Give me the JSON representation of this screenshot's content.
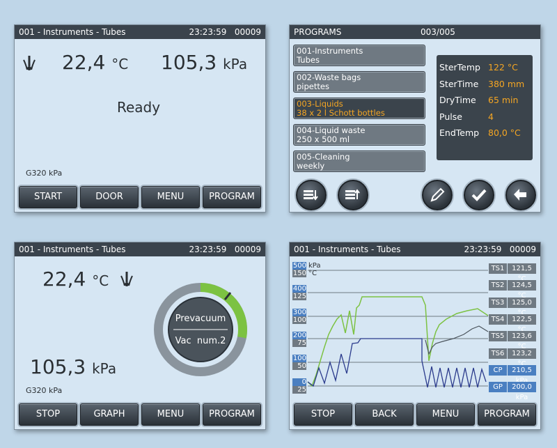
{
  "panel1": {
    "title": "001 - Instruments - Tubes",
    "time": "23:23:59",
    "counter": "00009",
    "temperature": "22,4",
    "temp_unit": "°C",
    "pressure": "105,3",
    "pressure_unit": "kPa",
    "status": "Ready",
    "gauge": "G320 kPa",
    "buttons": [
      "START",
      "DOOR",
      "MENU",
      "PROGRAM"
    ]
  },
  "panel2": {
    "title": "PROGRAMS",
    "page": "003/005",
    "programs": [
      {
        "line1": "001-Instruments",
        "line2": "Tubes"
      },
      {
        "line1": "002-Waste bags",
        "line2": "pipettes"
      },
      {
        "line1": "003-Liquids",
        "line2": "38 x 2 l Schott bottles"
      },
      {
        "line1": "004-Liquid waste",
        "line2": "250 x 500 ml"
      },
      {
        "line1": "005-Cleaning",
        "line2": "weekly"
      }
    ],
    "selected_index": 2,
    "params": [
      {
        "label": "SterTemp",
        "value": "122 °C"
      },
      {
        "label": "SterTime",
        "value": "380 mm"
      },
      {
        "label": "DryTime",
        "value": "65 min"
      },
      {
        "label": "Pulse",
        "value": "4"
      },
      {
        "label": "EndTemp",
        "value": "80,0 °C"
      }
    ],
    "icons": [
      "list-down-icon",
      "list-up-icon",
      "pencil-icon",
      "check-icon",
      "back-arrow-icon"
    ],
    "accent": "#f5a623"
  },
  "panel3": {
    "title": "001 - Instruments - Tubes",
    "time": "23:23:59",
    "counter": "00009",
    "temperature": "22,4",
    "temp_unit": "°C",
    "pressure": "105,3",
    "pressure_unit": "kPa",
    "gauge": "G320 kPa",
    "phase": "Prevacuum",
    "vac": "Vac  num.2",
    "progress_fraction": 0.28,
    "buttons": [
      "STOP",
      "GRAPH",
      "MENU",
      "PROGRAM"
    ]
  },
  "panel4": {
    "title": "001 - Instruments - Tubes",
    "time": "23:23:59",
    "counter": "00009",
    "pressure_axis": [
      "500",
      "400",
      "300",
      "200",
      "100",
      "0"
    ],
    "temp_axis": [
      "150",
      "125",
      "100",
      "75",
      "50",
      "25"
    ],
    "pressure_unit": "kPa",
    "temp_unit": "°C",
    "sensors": [
      {
        "label": "TS1",
        "value": "121,5 °C"
      },
      {
        "label": "TS2",
        "value": "124,5 °C"
      },
      {
        "label": "TS3",
        "value": "125,0 °C"
      },
      {
        "label": "TS4",
        "value": "122,5 °C"
      },
      {
        "label": "TS5",
        "value": "123,6 °C"
      },
      {
        "label": "TS6",
        "value": "123,2 °C"
      },
      {
        "label": "CP",
        "value": "210,5 kPa"
      },
      {
        "label": "GP",
        "value": "200,0 kPa"
      }
    ],
    "buttons": [
      "STOP",
      "BACK",
      "MENU",
      "PROGRAM"
    ]
  },
  "colors": {
    "green": "#7cc242",
    "blue_line": "#2a3a8c",
    "dark": "#3a434c"
  }
}
